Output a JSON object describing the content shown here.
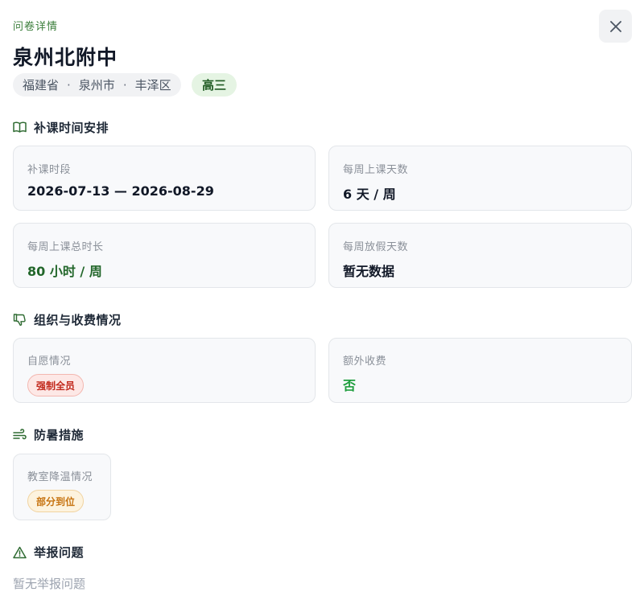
{
  "header": {
    "eyebrow": "问卷详情",
    "school_name": "泉州北附中",
    "close_icon": "close-icon"
  },
  "location": {
    "province": "福建省",
    "city": "泉州市",
    "district": "丰泽区",
    "separator": "·",
    "grade": "高三"
  },
  "sections": {
    "schedule": {
      "title": "补课时间安排",
      "icon": "book-open-icon",
      "cards": [
        {
          "label": "补课时段",
          "value": "2026-07-13 — 2026-08-29"
        },
        {
          "label": "每周上课天数",
          "value": "6 天 / 周"
        },
        {
          "label": "每周上课总时长",
          "value": "80 小时 / 周"
        },
        {
          "label": "每周放假天数",
          "value": "暂无数据"
        }
      ]
    },
    "organization": {
      "title": "组织与收费情况",
      "icon": "thumbs-down-icon",
      "cards": [
        {
          "label": "自愿情况",
          "value": "强制全员"
        },
        {
          "label": "额外收费",
          "value": "否"
        }
      ]
    },
    "heat": {
      "title": "防暑措施",
      "icon": "wind-icon",
      "cards": [
        {
          "label": "教室降温情况",
          "value": "部分到位"
        }
      ]
    },
    "report": {
      "title": "举报问题",
      "icon": "warning-triangle-icon",
      "empty_text": "暂无举报问题"
    }
  },
  "colors": {
    "accent_green": "#22662a",
    "danger_red": "#c2291d",
    "warning_orange": "#c77411",
    "success_green": "#1f9e3e"
  }
}
